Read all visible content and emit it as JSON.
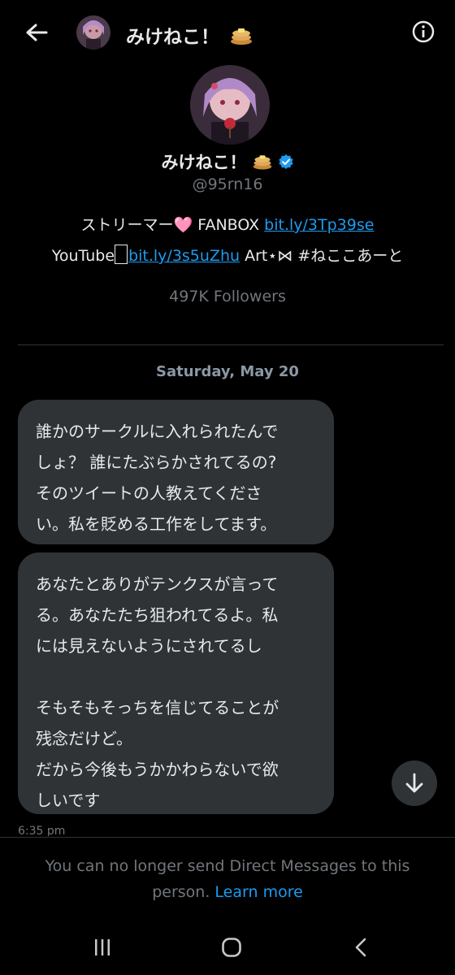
{
  "header": {
    "title": "みけねこ！"
  },
  "profile": {
    "name": "みけねこ！",
    "handle": "@95rn16",
    "bio_line1_text": "ストリーマー",
    "bio_line1_heart": "🩷",
    "bio_line1_fanbox": " FANBOX ",
    "bio_line1_link": "bit.ly/3Tp39se",
    "bio_line2_youtube": "YouTube",
    "bio_line2_link": "bit.ly/3s5uZhu",
    "bio_line2_art": " Art⋆⋈ #ねここあーと",
    "followers": "497K Followers"
  },
  "conversation": {
    "date_label": "Saturday, May 20",
    "messages": [
      {
        "lines": [
          "誰かのサークルに入れられたんで",
          "しょ？ 誰にたぶらかされてるの?",
          "そのツイートの人教えてくださ",
          "い。私を貶める工作をしてます。"
        ]
      },
      {
        "lines": [
          "あなたとありがテンクスが言って",
          "る。あなたたち狙われてるよ。私",
          "には見えないようにされてるし",
          "",
          "そもそもそっちを信じてることが",
          "残念だけど。",
          "だから今後もうかかわらないで欲",
          "しいです"
        ]
      }
    ],
    "timestamp": "6:35 pm"
  },
  "footer": {
    "notice": "You can no longer send Direct Messages to this person.",
    "learn_more": "Learn more"
  },
  "colors": {
    "background": "#000000",
    "bubble": "#2f3336",
    "link": "#1d9bf0",
    "muted": "#71767b",
    "verified": "#1d9bf0"
  },
  "icons": {
    "back": "arrow-left-icon",
    "info": "info-icon",
    "verified": "verified-badge-icon",
    "pancake": "pancake-emoji-icon",
    "scroll_down": "arrow-down-icon",
    "nav_recents": "recents-icon",
    "nav_home": "home-icon",
    "nav_back": "chevron-left-icon"
  }
}
